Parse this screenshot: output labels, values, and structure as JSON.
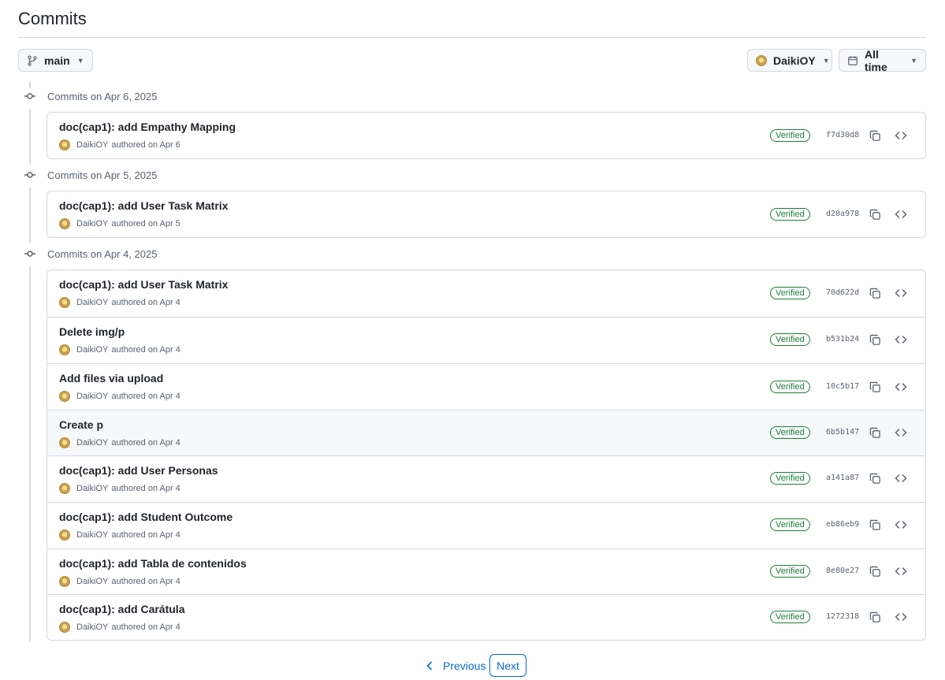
{
  "page": {
    "title": "Commits"
  },
  "toolbar": {
    "branch_label": "main",
    "author_label": "DaikiOY",
    "time_label": "All time"
  },
  "groups": [
    {
      "label": "Commits on Apr 6, 2025",
      "commits": [
        {
          "title": "doc(cap1): add Empathy Mapping",
          "author": "DaikiOY",
          "authored": "authored on Apr 6",
          "badge": "Verified",
          "sha": "f7d30d8"
        }
      ]
    },
    {
      "label": "Commits on Apr 5, 2025",
      "commits": [
        {
          "title": "doc(cap1): add User Task Matrix",
          "author": "DaikiOY",
          "authored": "authored on Apr 5",
          "badge": "Verified",
          "sha": "d20a978"
        }
      ]
    },
    {
      "label": "Commits on Apr 4, 2025",
      "commits": [
        {
          "title": "doc(cap1): add User Task Matrix",
          "author": "DaikiOY",
          "authored": "authored on Apr 4",
          "badge": "Verified",
          "sha": "70d622d"
        },
        {
          "title": "Delete img/p",
          "author": "DaikiOY",
          "authored": "authored on Apr 4",
          "badge": "Verified",
          "sha": "b531b24"
        },
        {
          "title": "Add files via upload",
          "author": "DaikiOY",
          "authored": "authored on Apr 4",
          "badge": "Verified",
          "sha": "10c5b17"
        },
        {
          "title": "Create p",
          "author": "DaikiOY",
          "authored": "authored on Apr 4",
          "badge": "Verified",
          "sha": "6b5b147"
        },
        {
          "title": "doc(cap1): add User Personas",
          "author": "DaikiOY",
          "authored": "authored on Apr 4",
          "badge": "Verified",
          "sha": "a141a87"
        },
        {
          "title": "doc(cap1): add Student Outcome",
          "author": "DaikiOY",
          "authored": "authored on Apr 4",
          "badge": "Verified",
          "sha": "eb86eb9"
        },
        {
          "title": "doc(cap1): add Tabla de contenidos",
          "author": "DaikiOY",
          "authored": "authored on Apr 4",
          "badge": "Verified",
          "sha": "8e80e27"
        },
        {
          "title": "doc(cap1): add Carátula",
          "author": "DaikiOY",
          "authored": "authored on Apr 4",
          "badge": "Verified",
          "sha": "1272318"
        }
      ]
    }
  ],
  "pagination": {
    "previous_label": "Previous",
    "next_label": "Next"
  },
  "icons": {
    "branch": "git-branch-icon",
    "calendar": "calendar-icon",
    "commit_node": "git-commit-icon",
    "copy": "copy-icon",
    "browse": "code-icon",
    "previous": "chevron-left-icon",
    "caret": "triangle-down-icon"
  },
  "colors": {
    "link": "#0969da",
    "verified": "#1a7f37",
    "border": "#d1d9e0",
    "muted": "#59636e"
  }
}
